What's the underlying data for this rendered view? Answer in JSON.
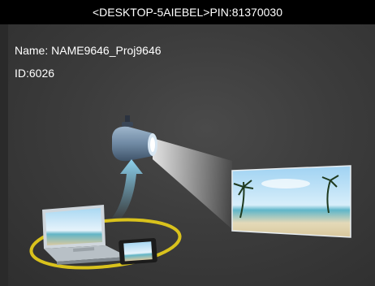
{
  "title_bar": {
    "device": "<DESKTOP-5AIEBEL>",
    "pin_label": "PIN:",
    "pin": "81370030"
  },
  "info": {
    "name_label": "Name:",
    "name": "NAME9646_Proj9646",
    "id_label": "ID:",
    "id": "6026"
  },
  "illustration": {
    "icons": [
      "projector-icon",
      "laptop-icon",
      "phone-icon",
      "projection-screen-icon",
      "cast-arrow-icon"
    ]
  }
}
